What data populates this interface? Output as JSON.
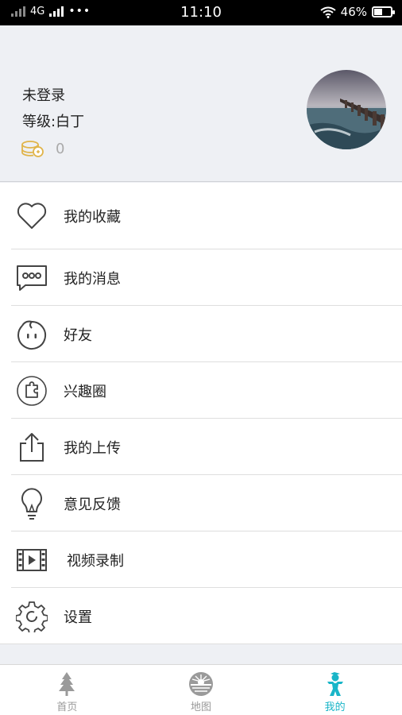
{
  "status_bar": {
    "network": "4G",
    "time": "11:10",
    "battery": "46%"
  },
  "profile": {
    "name": "未登录",
    "level": "等级:白丁",
    "coins": "0"
  },
  "menu": [
    {
      "label": "我的收藏",
      "icon": "heart-icon"
    },
    {
      "label": "我的消息",
      "icon": "message-icon"
    },
    {
      "label": "好友",
      "icon": "friend-face-icon"
    },
    {
      "label": "兴趣圈",
      "icon": "puzzle-circle-icon"
    },
    {
      "label": "我的上传",
      "icon": "upload-icon"
    },
    {
      "label": "意见反馈",
      "icon": "lightbulb-icon"
    },
    {
      "label": "视频录制",
      "icon": "film-icon"
    },
    {
      "label": "设置",
      "icon": "gear-icon"
    }
  ],
  "tabs": [
    {
      "label": "首页",
      "icon": "tree-icon"
    },
    {
      "label": "地图",
      "icon": "map-globe-icon"
    },
    {
      "label": "我的",
      "icon": "person-icon",
      "active": true
    }
  ],
  "colors": {
    "accent": "#19b5c8",
    "coin": "#e0b44a"
  }
}
